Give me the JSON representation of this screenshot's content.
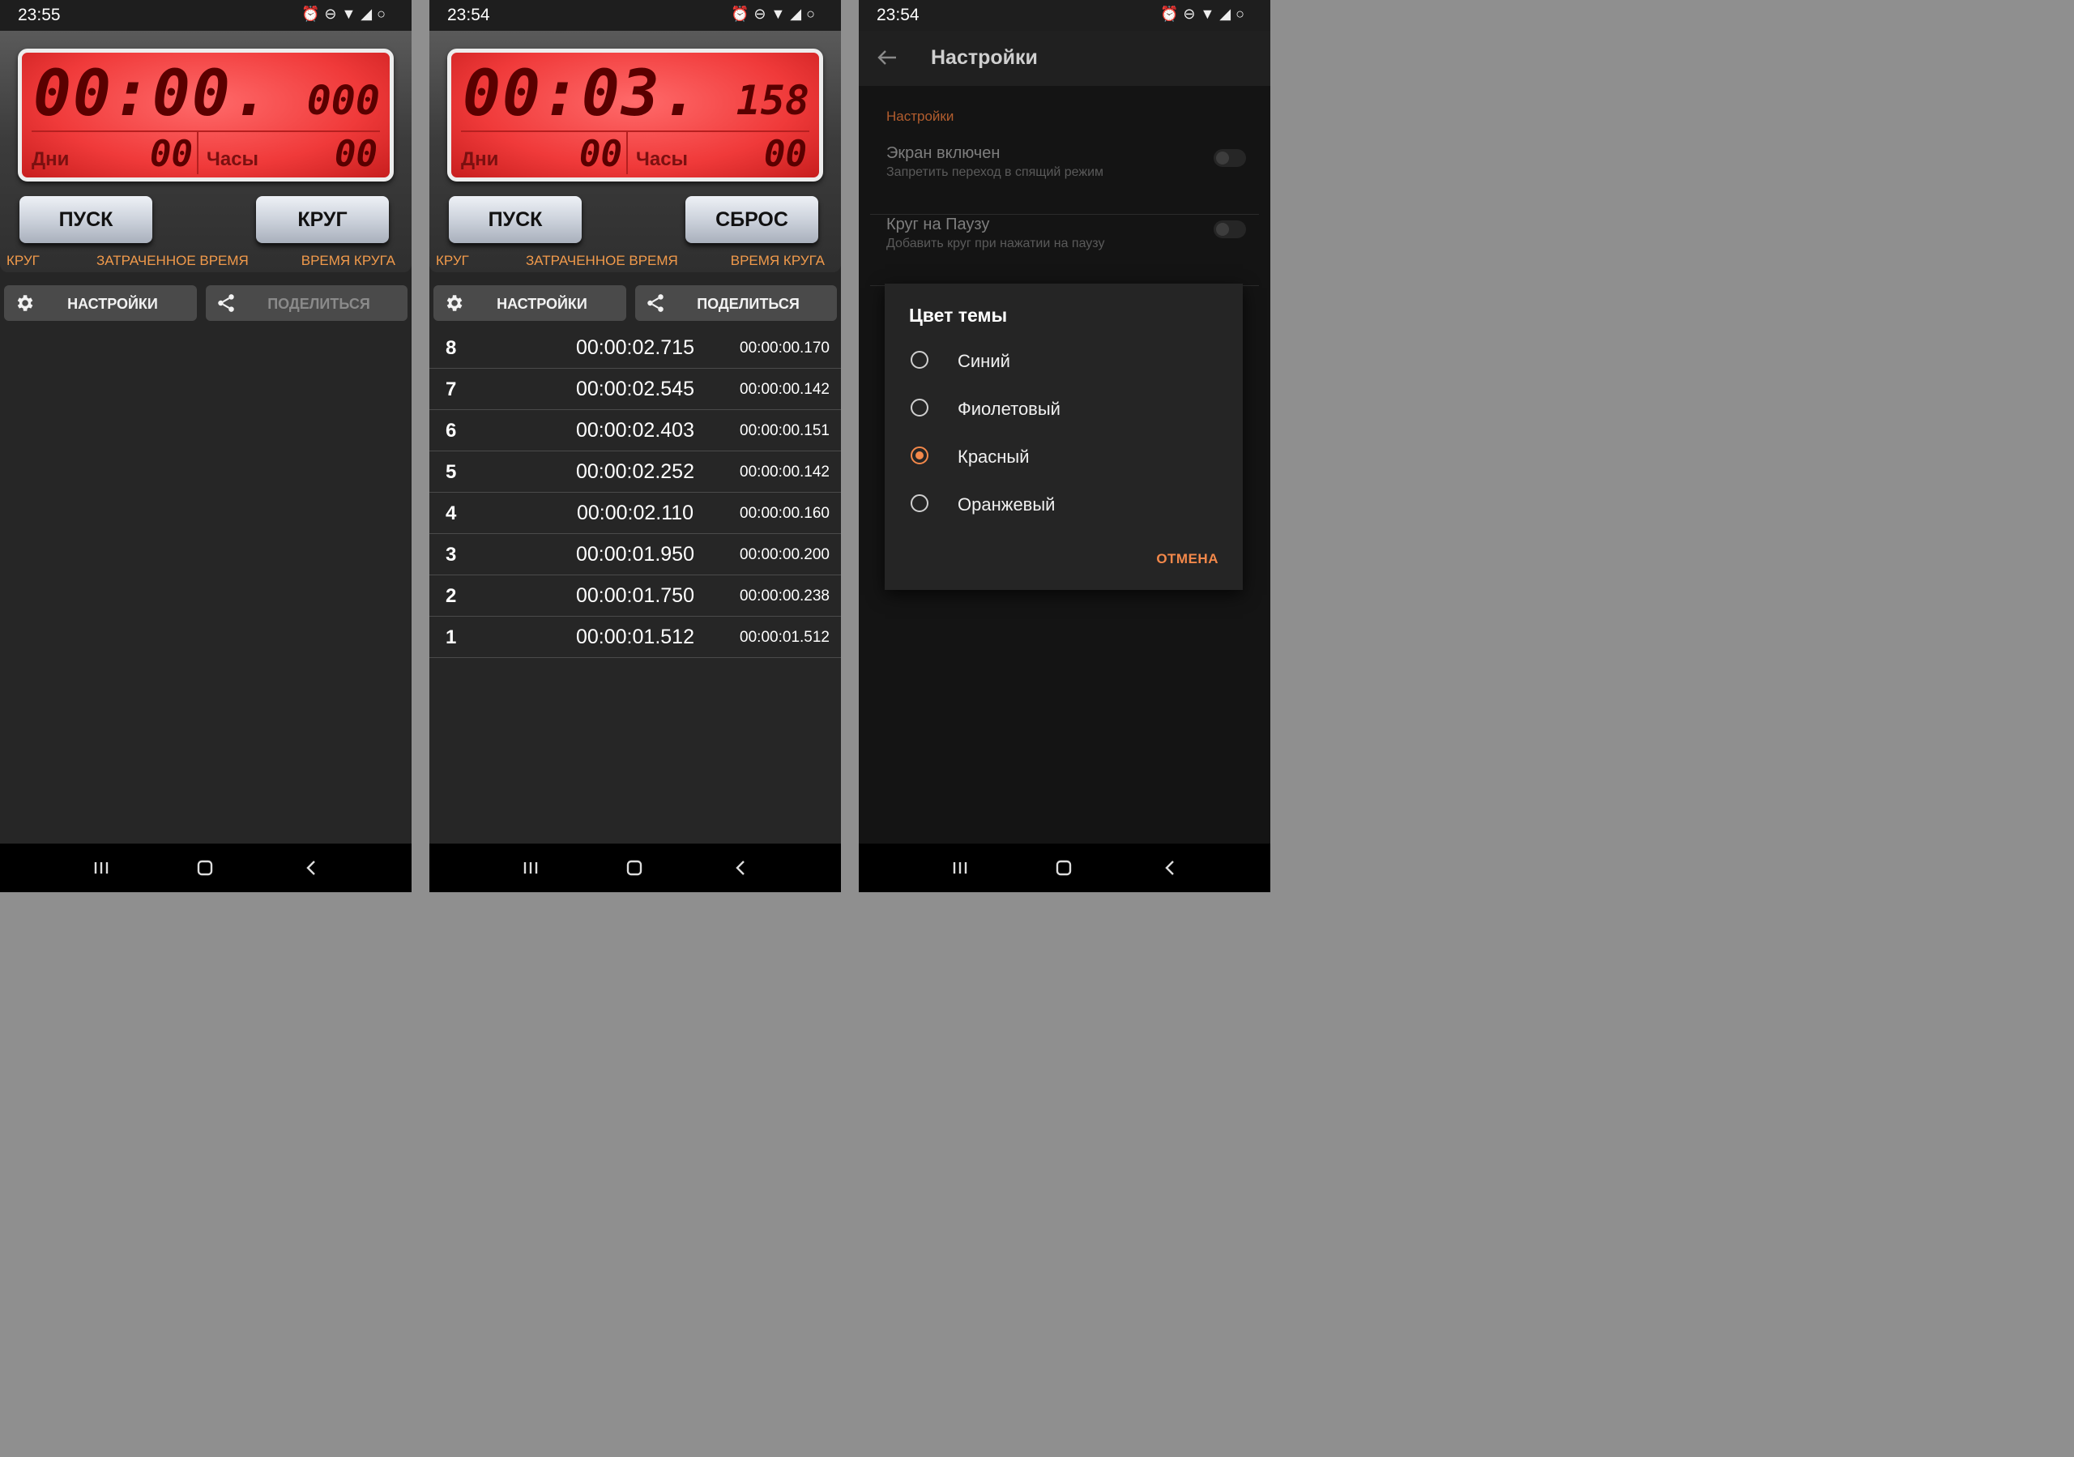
{
  "colors": {
    "accent": "#f3884a",
    "lcd": "#f03a3a",
    "label_orange": "#f19a4b"
  },
  "screen1": {
    "status_time": "23:55",
    "lcd": {
      "main": "00:00.",
      "ms": "000",
      "days_label": "Дни",
      "days": "00",
      "hours_label": "Часы",
      "hours": "00"
    },
    "start_label": "ПУСК",
    "lap_label": "КРУГ",
    "col_lap": "КРУГ",
    "col_elapsed": "ЗАТРАЧЕННОЕ ВРЕМЯ",
    "col_lap_time": "ВРЕМЯ КРУГА",
    "settings_label": "НАСТРОЙКИ",
    "share_label": "ПОДЕЛИТЬСЯ"
  },
  "screen2": {
    "status_time": "23:54",
    "lcd": {
      "main": "00:03.",
      "ms": "158",
      "days_label": "Дни",
      "days": "00",
      "hours_label": "Часы",
      "hours": "00"
    },
    "start_label": "ПУСК",
    "reset_label": "СБРОС",
    "col_lap": "КРУГ",
    "col_elapsed": "ЗАТРАЧЕННОЕ ВРЕМЯ",
    "col_lap_time": "ВРЕМЯ КРУГА",
    "settings_label": "НАСТРОЙКИ",
    "share_label": "ПОДЕЛИТЬСЯ",
    "laps": [
      {
        "n": "8",
        "total": "00:00:02.715",
        "lap": "00:00:00.170"
      },
      {
        "n": "7",
        "total": "00:00:02.545",
        "lap": "00:00:00.142"
      },
      {
        "n": "6",
        "total": "00:00:02.403",
        "lap": "00:00:00.151"
      },
      {
        "n": "5",
        "total": "00:00:02.252",
        "lap": "00:00:00.142"
      },
      {
        "n": "4",
        "total": "00:00:02.110",
        "lap": "00:00:00.160"
      },
      {
        "n": "3",
        "total": "00:00:01.950",
        "lap": "00:00:00.200"
      },
      {
        "n": "2",
        "total": "00:00:01.750",
        "lap": "00:00:00.238"
      },
      {
        "n": "1",
        "total": "00:00:01.512",
        "lap": "00:00:01.512"
      }
    ]
  },
  "screen3": {
    "status_time": "23:54",
    "title": "Настройки",
    "section": "Настройки",
    "prefs": [
      {
        "title": "Экран включен",
        "summary": "Запретить переход в спящий режим"
      },
      {
        "title": "Круг на Паузу",
        "summary": "Добавить круг при нажатии на паузу"
      }
    ],
    "dialog": {
      "title": "Цвет темы",
      "options": [
        "Синий",
        "Фиолетовый",
        "Красный",
        "Оранжевый"
      ],
      "selected": "Красный",
      "cancel": "ОТМЕНА"
    }
  },
  "icons": {
    "gear": "gear-icon",
    "share": "share-icon",
    "recents": "recents-icon",
    "home": "home-icon",
    "back": "back-icon",
    "arrow": "arrow-left-icon"
  }
}
